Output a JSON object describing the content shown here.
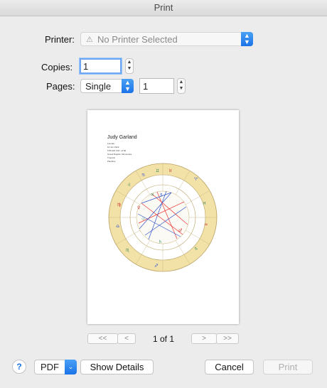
{
  "window": {
    "title": "Print"
  },
  "printer": {
    "label": "Printer:",
    "value": "No Printer Selected",
    "icon": "warning-icon"
  },
  "copies": {
    "label": "Copies:",
    "value": "1"
  },
  "pages": {
    "label": "Pages:",
    "mode": "Single",
    "page_value": "1"
  },
  "preview": {
    "name": "Judy Garland",
    "lines": [
      "Female",
      "10 Jun 1922",
      "5:55 AM CST +6:00",
      "Grand Rapids, Minnesota",
      "Tropical",
      "Placidus"
    ]
  },
  "pager": {
    "first": "<<",
    "prev": "<",
    "status": "1 of 1",
    "next": ">",
    "last": ">>"
  },
  "footer": {
    "help": "?",
    "pdf": "PDF",
    "show_details": "Show Details",
    "cancel": "Cancel",
    "print": "Print"
  },
  "colors": {
    "accent": "#1a73e8",
    "wheel_gold": "#f2e2a8",
    "aspect_red": "#e33",
    "aspect_blue": "#35c"
  }
}
